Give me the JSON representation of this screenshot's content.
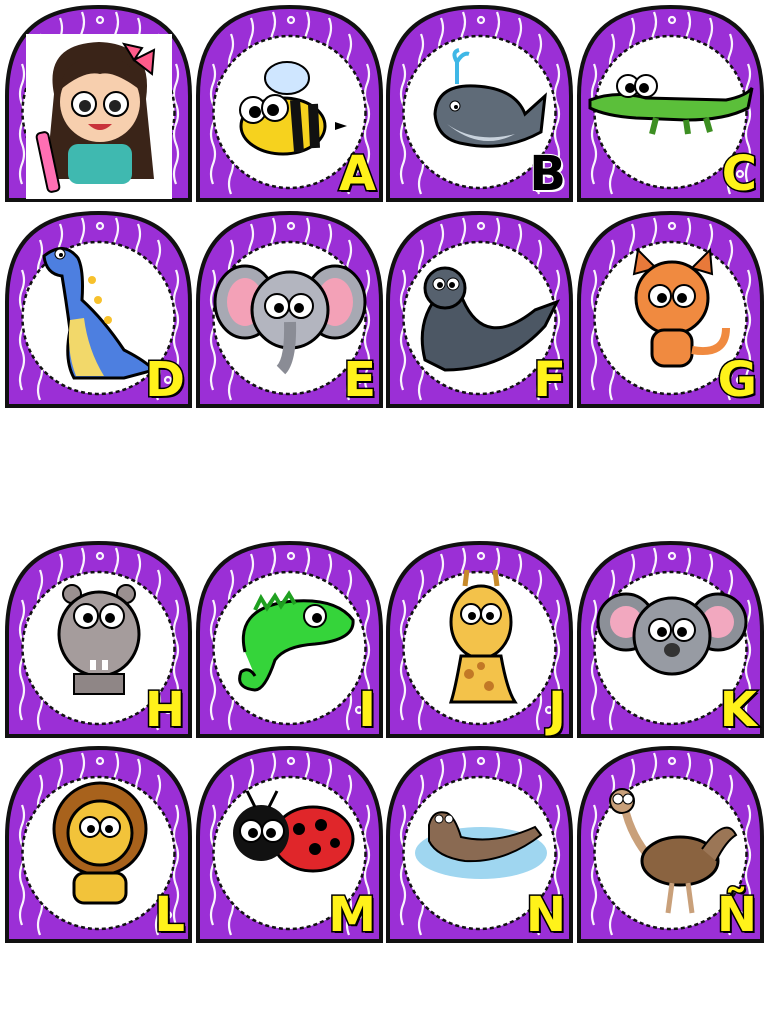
{
  "colors": {
    "frame": "#9b2fd6",
    "frame_dark": "#6c16a0",
    "border": "#111111",
    "letter": "#fff21a"
  },
  "cards": [
    {
      "letter": "",
      "icon": "girl-mascot-icon"
    },
    {
      "letter": "A",
      "icon": "bee-icon"
    },
    {
      "letter": "B",
      "icon": "whale-icon"
    },
    {
      "letter": "C",
      "icon": "crocodile-icon"
    },
    {
      "letter": "D",
      "icon": "dinosaur-icon"
    },
    {
      "letter": "E",
      "icon": "elephant-icon"
    },
    {
      "letter": "F",
      "icon": "seal-icon"
    },
    {
      "letter": "G",
      "icon": "cat-icon"
    },
    {
      "letter": "H",
      "icon": "hippo-icon"
    },
    {
      "letter": "I",
      "icon": "iguana-icon"
    },
    {
      "letter": "J",
      "icon": "giraffe-icon"
    },
    {
      "letter": "K",
      "icon": "koala-icon"
    },
    {
      "letter": "L",
      "icon": "lion-icon"
    },
    {
      "letter": "M",
      "icon": "ladybug-icon"
    },
    {
      "letter": "N",
      "icon": "otter-icon"
    },
    {
      "letter": "Ñ",
      "icon": "ostrich-icon"
    }
  ]
}
